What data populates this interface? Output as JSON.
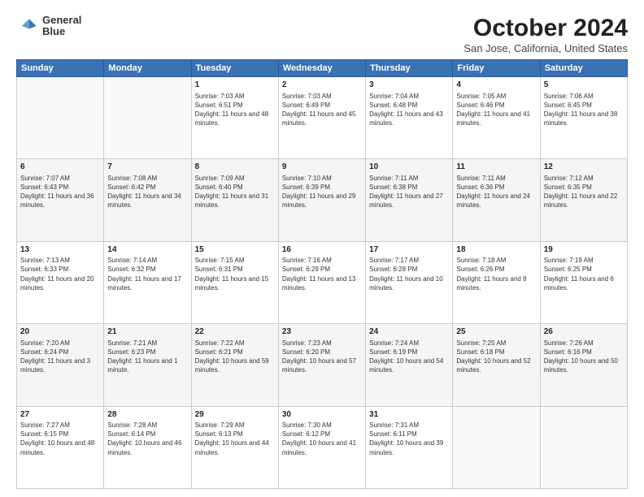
{
  "logo": {
    "text_line1": "General",
    "text_line2": "Blue"
  },
  "title": "October 2024",
  "subtitle": "San Jose, California, United States",
  "days_of_week": [
    "Sunday",
    "Monday",
    "Tuesday",
    "Wednesday",
    "Thursday",
    "Friday",
    "Saturday"
  ],
  "weeks": [
    [
      {
        "day": "",
        "info": ""
      },
      {
        "day": "",
        "info": ""
      },
      {
        "day": "1",
        "info": "Sunrise: 7:03 AM\nSunset: 6:51 PM\nDaylight: 11 hours and 48 minutes."
      },
      {
        "day": "2",
        "info": "Sunrise: 7:03 AM\nSunset: 6:49 PM\nDaylight: 11 hours and 45 minutes."
      },
      {
        "day": "3",
        "info": "Sunrise: 7:04 AM\nSunset: 6:48 PM\nDaylight: 11 hours and 43 minutes."
      },
      {
        "day": "4",
        "info": "Sunrise: 7:05 AM\nSunset: 6:46 PM\nDaylight: 11 hours and 41 minutes."
      },
      {
        "day": "5",
        "info": "Sunrise: 7:06 AM\nSunset: 6:45 PM\nDaylight: 11 hours and 38 minutes."
      }
    ],
    [
      {
        "day": "6",
        "info": "Sunrise: 7:07 AM\nSunset: 6:43 PM\nDaylight: 11 hours and 36 minutes."
      },
      {
        "day": "7",
        "info": "Sunrise: 7:08 AM\nSunset: 6:42 PM\nDaylight: 11 hours and 34 minutes."
      },
      {
        "day": "8",
        "info": "Sunrise: 7:09 AM\nSunset: 6:40 PM\nDaylight: 11 hours and 31 minutes."
      },
      {
        "day": "9",
        "info": "Sunrise: 7:10 AM\nSunset: 6:39 PM\nDaylight: 11 hours and 29 minutes."
      },
      {
        "day": "10",
        "info": "Sunrise: 7:11 AM\nSunset: 6:38 PM\nDaylight: 11 hours and 27 minutes."
      },
      {
        "day": "11",
        "info": "Sunrise: 7:11 AM\nSunset: 6:36 PM\nDaylight: 11 hours and 24 minutes."
      },
      {
        "day": "12",
        "info": "Sunrise: 7:12 AM\nSunset: 6:35 PM\nDaylight: 11 hours and 22 minutes."
      }
    ],
    [
      {
        "day": "13",
        "info": "Sunrise: 7:13 AM\nSunset: 6:33 PM\nDaylight: 11 hours and 20 minutes."
      },
      {
        "day": "14",
        "info": "Sunrise: 7:14 AM\nSunset: 6:32 PM\nDaylight: 11 hours and 17 minutes."
      },
      {
        "day": "15",
        "info": "Sunrise: 7:15 AM\nSunset: 6:31 PM\nDaylight: 11 hours and 15 minutes."
      },
      {
        "day": "16",
        "info": "Sunrise: 7:16 AM\nSunset: 6:29 PM\nDaylight: 11 hours and 13 minutes."
      },
      {
        "day": "17",
        "info": "Sunrise: 7:17 AM\nSunset: 6:28 PM\nDaylight: 11 hours and 10 minutes."
      },
      {
        "day": "18",
        "info": "Sunrise: 7:18 AM\nSunset: 6:26 PM\nDaylight: 11 hours and 8 minutes."
      },
      {
        "day": "19",
        "info": "Sunrise: 7:19 AM\nSunset: 6:25 PM\nDaylight: 11 hours and 6 minutes."
      }
    ],
    [
      {
        "day": "20",
        "info": "Sunrise: 7:20 AM\nSunset: 6:24 PM\nDaylight: 11 hours and 3 minutes."
      },
      {
        "day": "21",
        "info": "Sunrise: 7:21 AM\nSunset: 6:23 PM\nDaylight: 11 hours and 1 minute."
      },
      {
        "day": "22",
        "info": "Sunrise: 7:22 AM\nSunset: 6:21 PM\nDaylight: 10 hours and 59 minutes."
      },
      {
        "day": "23",
        "info": "Sunrise: 7:23 AM\nSunset: 6:20 PM\nDaylight: 10 hours and 57 minutes."
      },
      {
        "day": "24",
        "info": "Sunrise: 7:24 AM\nSunset: 6:19 PM\nDaylight: 10 hours and 54 minutes."
      },
      {
        "day": "25",
        "info": "Sunrise: 7:25 AM\nSunset: 6:18 PM\nDaylight: 10 hours and 52 minutes."
      },
      {
        "day": "26",
        "info": "Sunrise: 7:26 AM\nSunset: 6:16 PM\nDaylight: 10 hours and 50 minutes."
      }
    ],
    [
      {
        "day": "27",
        "info": "Sunrise: 7:27 AM\nSunset: 6:15 PM\nDaylight: 10 hours and 48 minutes."
      },
      {
        "day": "28",
        "info": "Sunrise: 7:28 AM\nSunset: 6:14 PM\nDaylight: 10 hours and 46 minutes."
      },
      {
        "day": "29",
        "info": "Sunrise: 7:29 AM\nSunset: 6:13 PM\nDaylight: 10 hours and 44 minutes."
      },
      {
        "day": "30",
        "info": "Sunrise: 7:30 AM\nSunset: 6:12 PM\nDaylight: 10 hours and 41 minutes."
      },
      {
        "day": "31",
        "info": "Sunrise: 7:31 AM\nSunset: 6:11 PM\nDaylight: 10 hours and 39 minutes."
      },
      {
        "day": "",
        "info": ""
      },
      {
        "day": "",
        "info": ""
      }
    ]
  ]
}
